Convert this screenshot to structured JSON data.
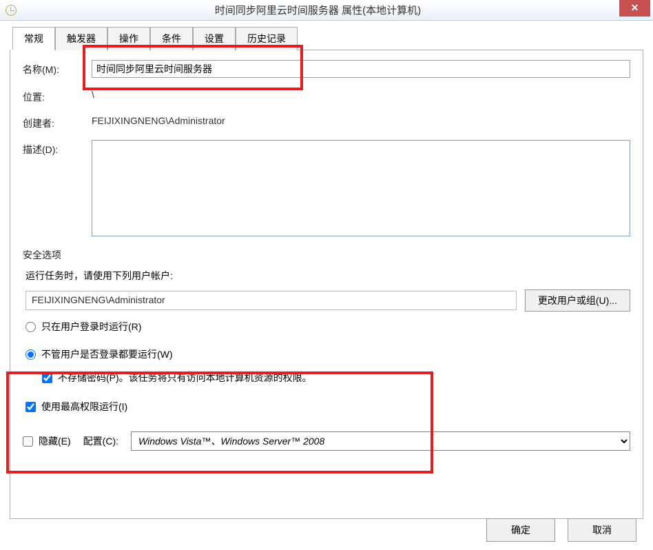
{
  "window": {
    "title": "时间同步阿里云时间服务器 属性(本地计算机)"
  },
  "tabs": {
    "general": "常规",
    "triggers": "触发器",
    "actions": "操作",
    "conditions": "条件",
    "settings": "设置",
    "history": "历史记录"
  },
  "general": {
    "name_label": "名称(M):",
    "name_value": "时间同步阿里云时间服务器",
    "location_label": "位置:",
    "location_value": "\\",
    "author_label": "创建者:",
    "author_value": "FEIJIXINGNENG\\Administrator",
    "desc_label": "描述(D):",
    "desc_value": ""
  },
  "security": {
    "section_label": "安全选项",
    "run_as_label": "运行任务时，请使用下列用户帐户:",
    "account": "FEIJIXINGNENG\\Administrator",
    "change_user_btn": "更改用户或组(U)...",
    "radio_logged_on": "只在用户登录时运行(R)",
    "radio_whether": "不管用户是否登录都要运行(W)",
    "chk_nopass": "不存储密码(P)。该任务将只有访问本地计算机资源的权限。",
    "chk_highest": "使用最高权限运行(I)"
  },
  "bottom": {
    "hidden_label": "隐藏(E)",
    "configure_label": "配置(C):",
    "configure_value": "Windows Vista™、Windows Server™ 2008"
  },
  "buttons": {
    "ok": "确定",
    "cancel": "取消"
  }
}
